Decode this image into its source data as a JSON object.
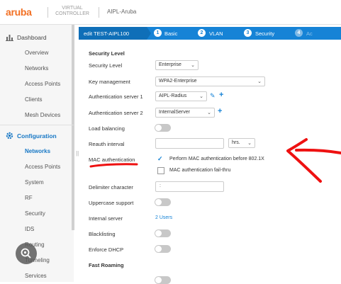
{
  "header": {
    "logo": "aruba",
    "product_line1": "VIRTUAL",
    "product_line2": "CONTROLLER",
    "cluster_name": "AIPL-Aruba"
  },
  "sidebar": {
    "dashboard": "Dashboard",
    "dashboard_items": [
      "Overview",
      "Networks",
      "Access Points",
      "Clients",
      "Mesh Devices"
    ],
    "configuration": "Configuration",
    "config_items": [
      "Networks",
      "Access Points",
      "System",
      "RF",
      "Security",
      "IDS",
      "Routing",
      "Tunneling",
      "Services"
    ]
  },
  "tabs": {
    "edit_label": "edit TEST-AIPL100",
    "steps": [
      {
        "num": "1",
        "label": "Basic"
      },
      {
        "num": "2",
        "label": "VLAN"
      },
      {
        "num": "3",
        "label": "Security"
      },
      {
        "num": "4",
        "label": "Ac"
      }
    ]
  },
  "form": {
    "section_security_level": "Security Level",
    "security_level": {
      "label": "Security Level",
      "value": "Enterprise"
    },
    "key_management": {
      "label": "Key management",
      "value": "WPA2-Enterprise"
    },
    "auth_server_1": {
      "label": "Authentication server 1",
      "value": "AIPL-Radius"
    },
    "auth_server_2": {
      "label": "Authentication server 2",
      "value": "InternalServer"
    },
    "load_balancing": {
      "label": "Load balancing",
      "enabled": false
    },
    "reauth_interval": {
      "label": "Reauth interval",
      "value": "",
      "unit": "hrs."
    },
    "mac_auth": {
      "label": "MAC authentication",
      "option1": {
        "label": "Perform MAC authentication before 802.1X",
        "checked": true
      },
      "option2": {
        "label": "MAC authentication fail-thru",
        "checked": false
      }
    },
    "delimiter": {
      "label": "Delimiter character",
      "value": ":"
    },
    "uppercase": {
      "label": "Uppercase support",
      "enabled": false
    },
    "internal_server": {
      "label": "Internal server",
      "value": "2 Users"
    },
    "blacklisting": {
      "label": "Blacklisting",
      "enabled": false
    },
    "enforce_dhcp": {
      "label": "Enforce DHCP",
      "enabled": false
    },
    "section_fast_roaming": "Fast Roaming"
  },
  "colors": {
    "brand": "#f27024",
    "accent": "#1683d6",
    "annotation": "#ee1111"
  }
}
